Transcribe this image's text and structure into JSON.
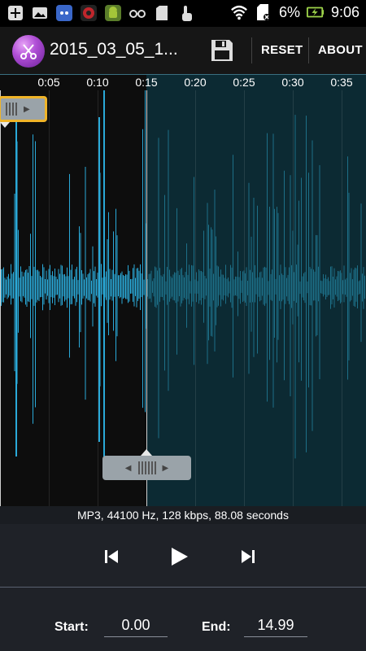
{
  "status_bar": {
    "left_icons": [
      "plus-icon",
      "image-icon",
      "chat-icon",
      "security-icon",
      "android-icon",
      "glasses-icon",
      "sd-card-icon",
      "touch-icon"
    ],
    "right_icons": [
      "wifi-icon",
      "no-sim-icon",
      "battery-charging-icon"
    ],
    "battery": "6%",
    "time": "9:06"
  },
  "action_bar": {
    "title": "2015_03_05_1...",
    "reset_label": "RESET",
    "about_label": "ABOUT",
    "icons": [
      "scissors-app-icon",
      "save-icon"
    ]
  },
  "timeline": {
    "labels": [
      "0:05",
      "0:10",
      "0:15",
      "0:20",
      "0:25",
      "0:30",
      "0:35"
    ]
  },
  "waveform": {
    "selection_start_sec": 0.0,
    "selection_end_sec": 14.99,
    "selected_color": "#2aa9d8",
    "unselected_color": "#1d6f87"
  },
  "info": {
    "text": "MP3, 44100 Hz, 128 kbps, 88.08 seconds"
  },
  "controls": {
    "icons": [
      "skip-previous-icon",
      "play-icon",
      "skip-next-icon"
    ]
  },
  "fields": {
    "start_label": "Start:",
    "start_value": "0.00",
    "end_label": "End:",
    "end_value": "14.99"
  },
  "colors": {
    "handle_border_active": "#f0b428",
    "background_dark": "#0c2a33"
  }
}
